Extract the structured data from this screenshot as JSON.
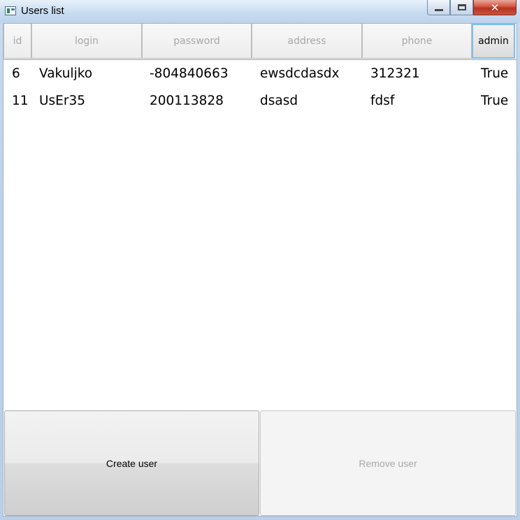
{
  "window": {
    "title": "Users list",
    "close_glyph": "✕"
  },
  "table": {
    "columns": [
      "id",
      "login",
      "password",
      "address",
      "phone",
      "admin"
    ],
    "rows": [
      {
        "id": "6",
        "login": "Vakuljko",
        "password": "-804840663",
        "address": "ewsdcdasdx",
        "phone": "312321",
        "admin": "True"
      },
      {
        "id": "11",
        "login": "UsEr35",
        "password": "200113828",
        "address": "dsasd",
        "phone": "fdsf",
        "admin": "True"
      }
    ],
    "active_column": "admin"
  },
  "buttons": {
    "create_label": "Create user",
    "remove_label": "Remove user"
  },
  "colors": {
    "close_button": "#c9533d",
    "active_header_border": "#7dc0ea"
  },
  "icons": {
    "window_icon": "app-window-icon",
    "minimize": "minimize-icon",
    "maximize": "maximize-icon",
    "close": "close-icon"
  }
}
